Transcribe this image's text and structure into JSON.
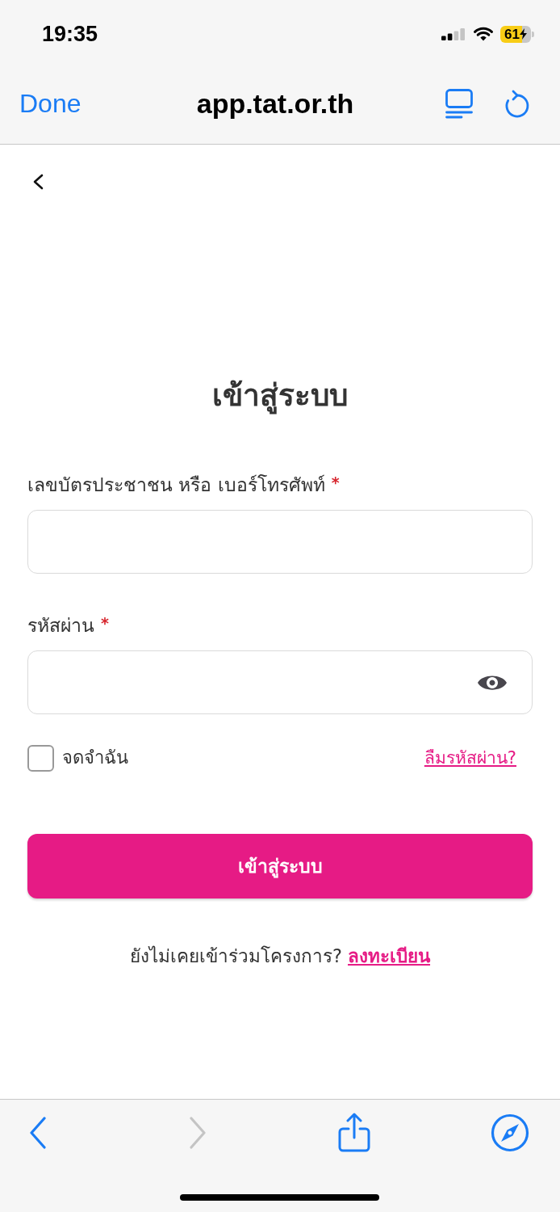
{
  "status_bar": {
    "time": "19:35",
    "battery": "61"
  },
  "browser_bar": {
    "done": "Done",
    "url": "app.tat.or.th"
  },
  "page": {
    "title": "เข้าสู่ระบบ",
    "fields": [
      {
        "kind": "text",
        "label": "เลขบัตรประชาชน หรือ เบอร์โทรศัพท์",
        "required_mark": "*"
      },
      {
        "kind": "password",
        "label": "รหัสผ่าน",
        "required_mark": "*"
      }
    ],
    "remember": {
      "label": "จดจำฉัน",
      "checked": false
    },
    "forgot_link": "ลืมรหัสผ่าน?",
    "submit": "เข้าสู่ระบบ",
    "register": {
      "prompt": "ยังไม่เคยเข้าร่วมโครงการ?",
      "link": "ลงทะเบียน"
    }
  },
  "toolbar": {
    "items": [
      {
        "kind": "back",
        "disabled": false
      },
      {
        "kind": "forward",
        "disabled": true
      },
      {
        "kind": "share",
        "disabled": false
      },
      {
        "kind": "compass",
        "disabled": false
      }
    ]
  }
}
